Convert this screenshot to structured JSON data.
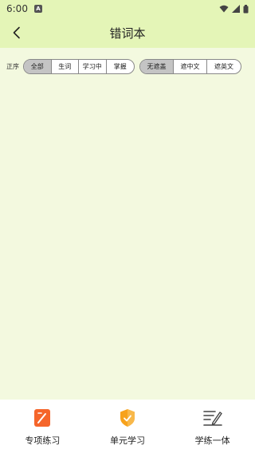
{
  "status_bar": {
    "time": "6:00",
    "notif_letter": "A"
  },
  "header": {
    "title": "错词本"
  },
  "filter": {
    "sort_label": "正序",
    "group1": [
      "全部",
      "生词",
      "学习中",
      "掌握"
    ],
    "group2": [
      "无遮盖",
      "遮中文",
      "遮英文"
    ],
    "active1_index": 0,
    "active2_index": 0
  },
  "bottom_nav": [
    {
      "label": "专项练习",
      "icon": "pencil-note-icon",
      "color": "#f5652a"
    },
    {
      "label": "单元学习",
      "icon": "shield-check-icon",
      "color": "#f7a21b"
    },
    {
      "label": "学练一体",
      "icon": "edit-lines-icon",
      "color": "#444444"
    }
  ],
  "colors": {
    "header_bg": "#e4f5b7",
    "page_bg": "#f3f9df",
    "active_seg": "#c4c4c4"
  }
}
